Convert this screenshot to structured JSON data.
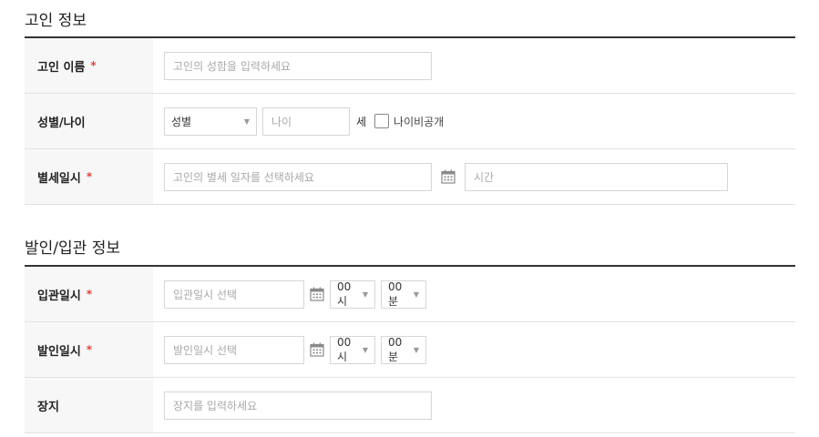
{
  "deceased": {
    "section_title": "고인 정보",
    "name": {
      "label": "고인 이름",
      "required_mark": "*",
      "placeholder": "고인의 성함을 입력하세요"
    },
    "gender_age": {
      "label": "성별/나이",
      "gender_select_value": "성별",
      "age_placeholder": "나이",
      "age_unit": "세",
      "hide_age_label": "나이비공개"
    },
    "death_datetime": {
      "label": "별세일시",
      "required_mark": "*",
      "date_placeholder": "고인의 별세 일자를 선택하세요",
      "time_placeholder": "시간"
    }
  },
  "funeral": {
    "section_title": "발인/입관 정보",
    "encoffin": {
      "label": "입관일시",
      "required_mark": "*",
      "date_placeholder": "입관일시 선택",
      "hour_value": "00시",
      "minute_value": "00분"
    },
    "departure": {
      "label": "발인일시",
      "required_mark": "*",
      "date_placeholder": "발인일시 선택",
      "hour_value": "00시",
      "minute_value": "00분"
    },
    "burial": {
      "label": "장지",
      "placeholder": "장지를 입력하세요"
    }
  },
  "icons": {
    "calendar": "calendar-icon",
    "dropdown": "caret-down-icon"
  }
}
